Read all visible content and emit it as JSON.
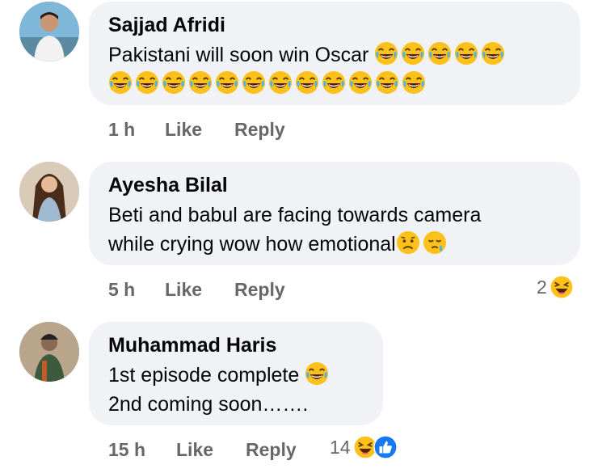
{
  "comments": [
    {
      "name": "Sajjad Afridi",
      "text_lines": [
        "Pakistani will soon win Oscar"
      ],
      "time": "1 h",
      "like": "Like",
      "reply": "Reply",
      "emoji_line1_count": 5,
      "emoji_line2_count": 12,
      "emoji": "laughing-tears-icon"
    },
    {
      "name": "Ayesha Bilal",
      "text_lines": [
        "Beti and babul are facing towards camera",
        "while crying wow how emotional"
      ],
      "time": "5 h",
      "like": "Like",
      "reply": "Reply",
      "reaction_count": "2",
      "reaction_icon": "haha-icon",
      "trailing_emojis": [
        "sad-face-icon",
        "crying-sleepy-icon"
      ]
    },
    {
      "name": "Muhammad Haris",
      "text_lines": [
        "1st episode complete",
        "2nd coming soon……."
      ],
      "time": "15 h",
      "like": "Like",
      "reply": "Reply",
      "reaction_count": "14",
      "reaction_icons": [
        "haha-icon",
        "like-icon"
      ]
    }
  ],
  "colors": {
    "bubble": "#f0f2f5",
    "meta_text": "#65676b",
    "emoji_yellow": "#fcc21b",
    "like_blue": "#1877f2"
  }
}
